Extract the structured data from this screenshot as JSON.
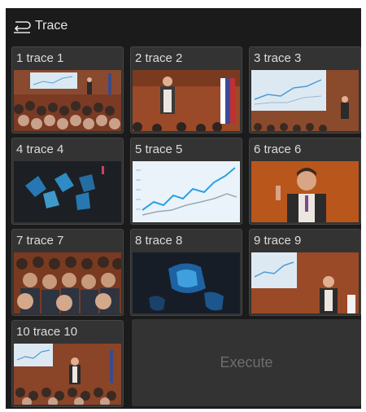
{
  "header": {
    "title": "Trace",
    "icon": "trace-return-icon"
  },
  "tiles": [
    {
      "label": "1 trace 1",
      "thumb": "conference-audience-with-speaker-and-screen"
    },
    {
      "label": "2 trace 2",
      "thumb": "speaker-at-podium"
    },
    {
      "label": "3 trace 3",
      "thumb": "screen-chart-with-speaker"
    },
    {
      "label": "4 trace 4",
      "thumb": "ultrasound-scan-dark"
    },
    {
      "label": "5 trace 5",
      "thumb": "line-chart-cyan"
    },
    {
      "label": "6 trace 6",
      "thumb": "speaker-closeup-orange-wall"
    },
    {
      "label": "7 trace 7",
      "thumb": "audience-crowd"
    },
    {
      "label": "8 trace 8",
      "thumb": "ultrasound-scan-blue"
    },
    {
      "label": "9 trace 9",
      "thumb": "speaker-with-screen"
    },
    {
      "label": "10 trace 10",
      "thumb": "speaker-with-screen-audience"
    }
  ],
  "execute": {
    "label": "Execute"
  },
  "colors": {
    "panel": "#1b1b1b",
    "tile": "#333333",
    "text": "#dcdcdc",
    "disabled_text": "#6e6e6e"
  }
}
